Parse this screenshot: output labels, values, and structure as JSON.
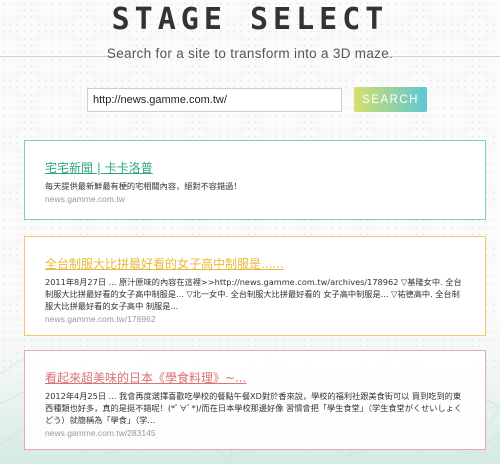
{
  "header": {
    "title": "STAGE SELECT",
    "subtitle": "Search for a site to transform into a 3D maze."
  },
  "search": {
    "value": "http://news.gamme.com.tw/",
    "button_label": "SEARCH"
  },
  "results": [
    {
      "title": "宅宅新聞 | 卡卡洛普",
      "description": "每天提供最新鮮最有梗的宅相關內容，絕對不容錯過！",
      "url": "news.gamme.com.tw",
      "accent": "#2ea884"
    },
    {
      "title": "全台制服大比拼最好看的女子高中制服是......",
      "description": "2011年8月27日 ... 原汁原味的內容在這裡>>http://news.gamme.com.tw/archives/178962 ▽基隆女中. 全台制服大比拼最好看的女子高中制服是... ▽北一女中. 全台制服大比拼最好看的 女子高中制服是... ▽祐德高中. 全台制服大比拼最好看的女子高中 制服是...",
      "url": "news.gamme.com.tw/178962",
      "accent": "#e9b93c"
    },
    {
      "title": "看起來超美味的日本《學食料理》~...",
      "description": "2012年4月25日 ... 我會再度選擇喜歡吃學校的餐點午餐XD對於香來說，學校的福利社跟美食街可以 買到吃到的東西種類也好多，真的是挺不錯呢！(*ﾟ∀ﾟ*)/而在日本學校那邊好像 習慣會把「學生食堂」（学生食堂がくせいしょくどう）就簡稱為「學食」（学...",
      "url": "news.gamme.com.tw/283145",
      "accent": "#d87474"
    }
  ]
}
